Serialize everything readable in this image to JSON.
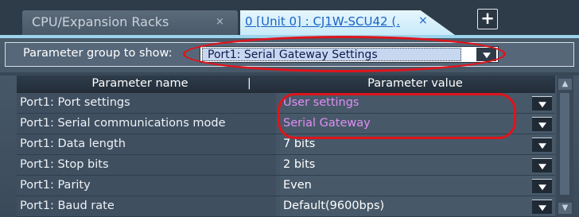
{
  "tabs": [
    {
      "label": "CPU/Expansion Racks",
      "close": "×"
    },
    {
      "label": "0 [Unit 0] : CJ1W-SCU42 (.",
      "close": "×"
    }
  ],
  "add_tab_label": "+",
  "parameter_group": {
    "label": "Parameter group to show:",
    "selected": "Port1: Serial Gateway Settings"
  },
  "grid": {
    "columns": [
      "Parameter name",
      "Parameter value"
    ],
    "header_separator": "|",
    "rows": [
      {
        "name": "Port1: Port settings",
        "value": "User settings",
        "changed": true
      },
      {
        "name": "Port1: Serial communications mode",
        "value": "Serial Gateway",
        "changed": true
      },
      {
        "name": "Port1: Data length",
        "value": "7 bits",
        "changed": false
      },
      {
        "name": "Port1: Stop bits",
        "value": "2 bits",
        "changed": false
      },
      {
        "name": "Port1: Parity",
        "value": "Even",
        "changed": false
      },
      {
        "name": "Port1: Baud rate",
        "value": "Default(9600bps)",
        "changed": false
      }
    ]
  },
  "colors": {
    "changed_value": "#e08ef3",
    "default_value": "#ffffff",
    "highlight_annotation": "#e0141b",
    "active_tab": "#c8eaf9"
  },
  "icons": {
    "dropdown": "triangle-down-icon",
    "scroll_up": "chevron-up-icon",
    "scroll_down": "chevron-down-icon",
    "add": "plus-icon",
    "close": "close-icon"
  }
}
